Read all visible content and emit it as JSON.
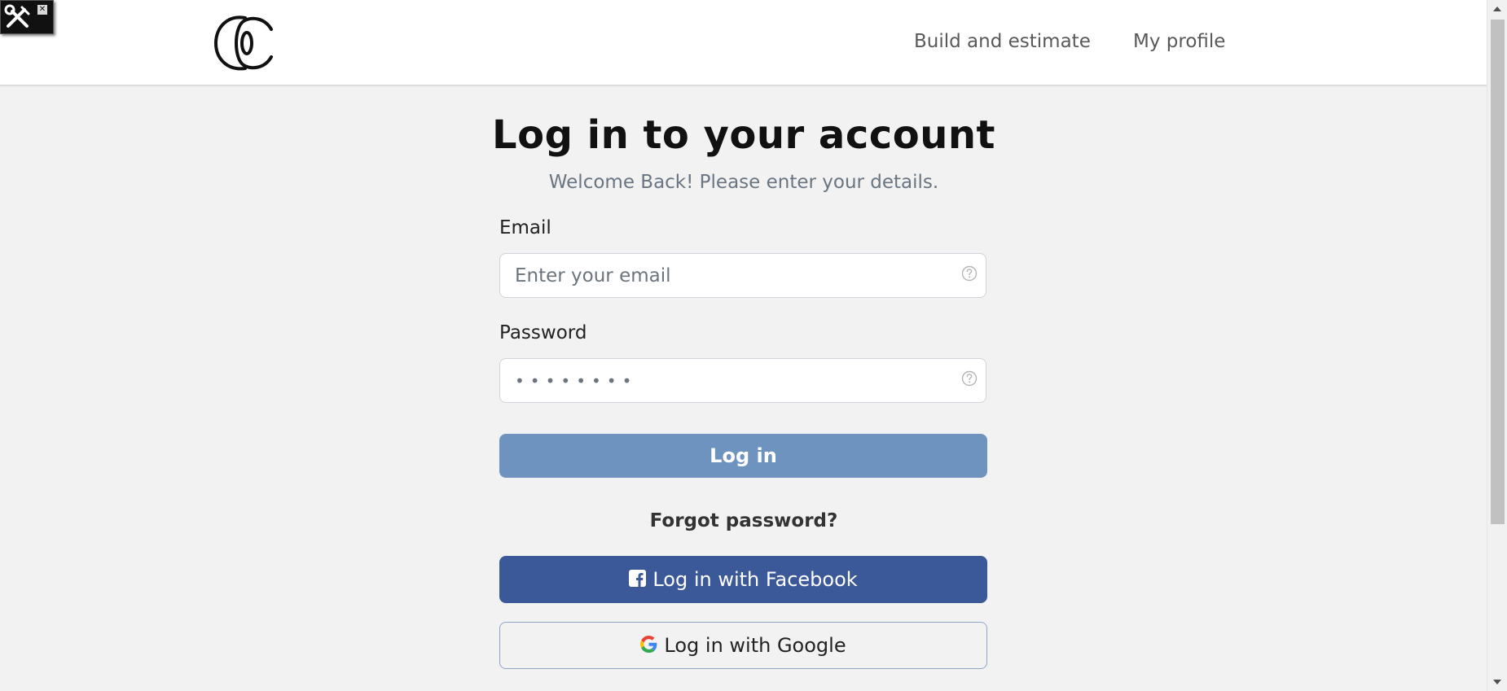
{
  "header": {
    "logo": "c-logo",
    "nav": {
      "build": "Build and estimate",
      "profile": "My profile"
    }
  },
  "page": {
    "title": "Log in to your account",
    "subtitle": "Welcome Back! Please enter your details."
  },
  "form": {
    "email": {
      "label": "Email",
      "placeholder": "Enter your email",
      "value": ""
    },
    "password": {
      "label": "Password",
      "value": "••••••••"
    },
    "login_label": "Log in",
    "forgot_label": "Forgot password?"
  },
  "social": {
    "facebook_label": "Log in with Facebook",
    "google_label": "Log in with Google"
  },
  "colors": {
    "login_button": "#6f93bf",
    "facebook": "#3b5998",
    "page_background": "#f2f2f2"
  },
  "icons": {
    "devtool": "wrench-screwdriver-icon",
    "help": "question-circle-icon",
    "facebook": "facebook-icon",
    "google": "google-icon"
  }
}
